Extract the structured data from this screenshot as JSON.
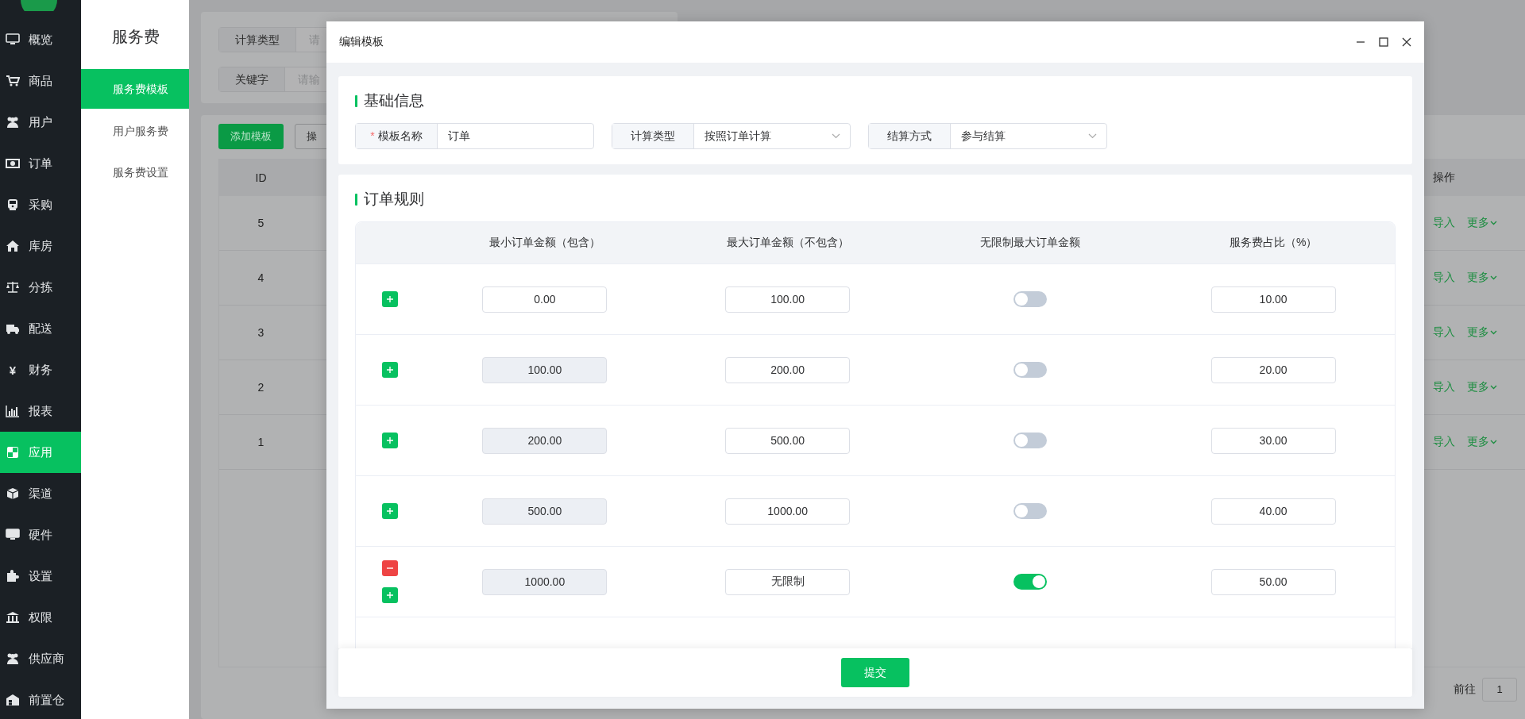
{
  "nav": {
    "items": [
      {
        "label": "概览",
        "selected": false
      },
      {
        "label": "商品",
        "selected": false
      },
      {
        "label": "用户",
        "selected": false
      },
      {
        "label": "订单",
        "selected": false
      },
      {
        "label": "采购",
        "selected": false
      },
      {
        "label": "库房",
        "selected": false
      },
      {
        "label": "分拣",
        "selected": false
      },
      {
        "label": "配送",
        "selected": false
      },
      {
        "label": "财务",
        "selected": false,
        "icon_text": "¥"
      },
      {
        "label": "报表",
        "selected": false
      },
      {
        "label": "应用",
        "selected": true
      },
      {
        "label": "渠道",
        "selected": false
      },
      {
        "label": "硬件",
        "selected": false
      },
      {
        "label": "设置",
        "selected": false
      },
      {
        "label": "权限",
        "selected": false
      },
      {
        "label": "供应商",
        "selected": false
      },
      {
        "label": "前置仓",
        "selected": false
      }
    ]
  },
  "submenu": {
    "title": "服务费",
    "items": [
      {
        "label": "服务费模板",
        "selected": true
      },
      {
        "label": "用户服务费",
        "selected": false
      },
      {
        "label": "服务费设置",
        "selected": false
      }
    ]
  },
  "filters": [
    {
      "label": "计算类型",
      "placeholder": "请"
    },
    {
      "label": "关键字",
      "placeholder": "请输"
    }
  ],
  "list_toolbar": {
    "add_button": "添加模板",
    "ops_button": "操"
  },
  "list_table": {
    "columns": [
      "ID",
      "操作"
    ],
    "rows": [
      {
        "id": "5",
        "actions": [
          "导入",
          "更多"
        ]
      },
      {
        "id": "4",
        "actions": [
          "导入",
          "更多"
        ]
      },
      {
        "id": "3",
        "actions": [
          "导入",
          "更多"
        ]
      },
      {
        "id": "2",
        "actions": [
          "导入",
          "更多"
        ]
      },
      {
        "id": "1",
        "actions": [
          "导入",
          "更多"
        ]
      }
    ]
  },
  "pagination": {
    "goto_label": "前往",
    "page": "1"
  },
  "dialog": {
    "title": "编辑模板",
    "basic": {
      "title": "基础信息",
      "fields": [
        {
          "required_mark": "*",
          "label": "模板名称",
          "value": "订单",
          "kind": "text"
        },
        {
          "label": "计算类型",
          "value": "按照订单计算",
          "kind": "select"
        },
        {
          "label": "结算方式",
          "value": "参与结算",
          "kind": "select"
        }
      ]
    },
    "rules": {
      "title": "订单规则",
      "columns": [
        "最小订单金额（包含）",
        "最大订单金额（不包含）",
        "无限制最大订单金额",
        "服务费占比（%）"
      ],
      "rows": [
        {
          "min": "0.00",
          "min_disabled": false,
          "max": "100.00",
          "unlimited": false,
          "ratio": "10.00",
          "removable": false
        },
        {
          "min": "100.00",
          "min_disabled": true,
          "max": "200.00",
          "unlimited": false,
          "ratio": "20.00",
          "removable": false
        },
        {
          "min": "200.00",
          "min_disabled": true,
          "max": "500.00",
          "unlimited": false,
          "ratio": "30.00",
          "removable": false
        },
        {
          "min": "500.00",
          "min_disabled": true,
          "max": "1000.00",
          "unlimited": false,
          "ratio": "40.00",
          "removable": false
        },
        {
          "min": "1000.00",
          "min_disabled": true,
          "max": "无限制",
          "unlimited": true,
          "ratio": "50.00",
          "removable": true
        }
      ]
    },
    "submit": "提交"
  }
}
